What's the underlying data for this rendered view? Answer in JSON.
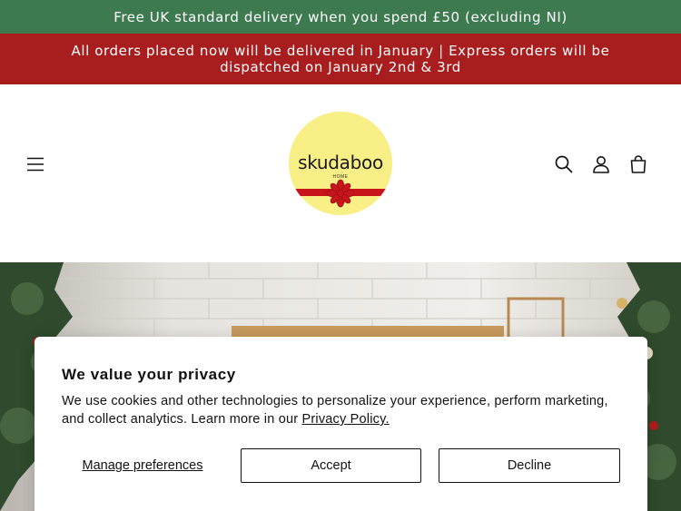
{
  "announcements": {
    "delivery": "Free UK standard delivery when you spend £50 (excluding NI)",
    "notice": "All orders placed now will be delivered in January | Express orders will be dispatched on January 2nd & 3rd"
  },
  "header": {
    "logo_name": "skudaboo",
    "logo_sub": "HOME",
    "icons": [
      "menu-icon",
      "search-icon",
      "account-icon",
      "cart-icon"
    ]
  },
  "colors": {
    "announcement_green": "#3e7a4f",
    "announcement_red": "#a81d1d",
    "logo_yellow": "#f8ef86",
    "ribbon_red": "#c8141b"
  },
  "privacy": {
    "title": "We value your privacy",
    "body": "We use cookies and other technologies to personalize your experience, perform marketing, and collect analytics. Learn more in our ",
    "link": "Privacy Policy.",
    "manage_label": "Manage preferences",
    "accept_label": "Accept",
    "decline_label": "Decline"
  }
}
